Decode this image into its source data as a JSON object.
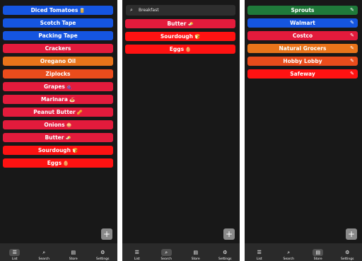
{
  "colors": {
    "blue": "#1555e0",
    "red": "#e31b3c",
    "orange": "#e8741a",
    "orangered": "#ea4c1c",
    "brightred": "#ff1212",
    "green": "#1f7a3a",
    "panel_bg": "#181818",
    "nav_bg": "#2a2a2a"
  },
  "list_panel": {
    "items": [
      {
        "label": "Diced Tomatoes",
        "emoji": "🥫",
        "color": "#1555e0"
      },
      {
        "label": "Scotch Tape",
        "emoji": "",
        "color": "#1555e0"
      },
      {
        "label": "Packing Tape",
        "emoji": "",
        "color": "#1555e0"
      },
      {
        "label": "Crackers",
        "emoji": "",
        "color": "#e31b3c"
      },
      {
        "label": "Oregano Oil",
        "emoji": "",
        "color": "#e8741a"
      },
      {
        "label": "Ziplocks",
        "emoji": "",
        "color": "#ea4c1c"
      },
      {
        "label": "Grapes",
        "emoji": "🍇",
        "color": "#e31b3c"
      },
      {
        "label": "Marinara",
        "emoji": "🍝",
        "color": "#e31b3c"
      },
      {
        "label": "Peanut Butter",
        "emoji": "🥜",
        "color": "#e31b3c"
      },
      {
        "label": "Onions",
        "emoji": "🧅",
        "color": "#e31b3c"
      },
      {
        "label": "Butter",
        "emoji": "🧈",
        "color": "#e31b3c"
      },
      {
        "label": "Sourdough",
        "emoji": "🍞",
        "color": "#ff1212"
      },
      {
        "label": "Eggs",
        "emoji": "🥚",
        "color": "#ff1212"
      }
    ]
  },
  "search_panel": {
    "search_value": "Breakfast",
    "items": [
      {
        "label": "Butter",
        "emoji": "🧈",
        "color": "#e31b3c"
      },
      {
        "label": "Sourdough",
        "emoji": "🍞",
        "color": "#ff1212"
      },
      {
        "label": "Eggs",
        "emoji": "🥚",
        "color": "#ff1212"
      }
    ]
  },
  "store_panel": {
    "items": [
      {
        "label": "Sprouts",
        "color": "#1f7a3a"
      },
      {
        "label": "Walmart",
        "color": "#1555e0"
      },
      {
        "label": "Costco",
        "color": "#e31b3c"
      },
      {
        "label": "Natural Grocers",
        "color": "#e8741a"
      },
      {
        "label": "Hobby Lobby",
        "color": "#ea4c1c"
      },
      {
        "label": "Safeway",
        "color": "#ff1212"
      }
    ]
  },
  "nav": {
    "tabs": [
      {
        "label": "List",
        "icon": "list-icon"
      },
      {
        "label": "Search",
        "icon": "search-icon"
      },
      {
        "label": "Store",
        "icon": "store-icon"
      },
      {
        "label": "Settings",
        "icon": "gear-icon"
      }
    ]
  },
  "fab_label": "+"
}
